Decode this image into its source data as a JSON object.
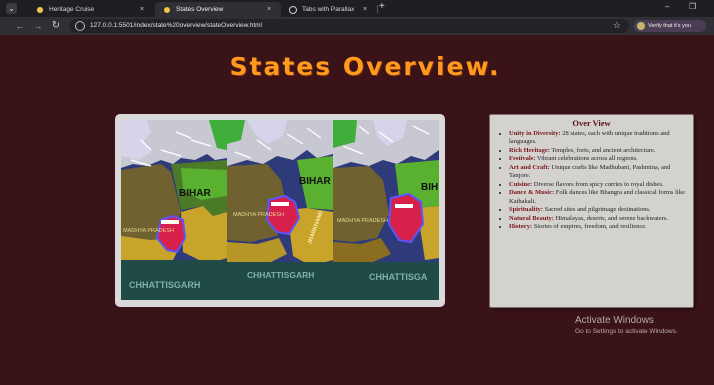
{
  "browser": {
    "tabs": [
      {
        "title": "Heritage Cruise",
        "close": "×",
        "active": false
      },
      {
        "title": "States Overview",
        "close": "×",
        "active": true
      },
      {
        "title": "Tabs with Parallax Carousel",
        "close": "×",
        "active": false
      }
    ],
    "new_tab": "+",
    "minimize": "–",
    "restore": "❐",
    "url": "127.0.0.1:5501/index/state%20overview/stateOverview.html",
    "verify_label": "Verify that it's you",
    "icons": {
      "back": "arrow-left",
      "forward": "arrow-right",
      "reload": "reload",
      "bookmark": "star"
    }
  },
  "page": {
    "heading": "States Overview.",
    "map_labels": {
      "p1": [
        "BIHAR",
        "MADHYA PRADESH",
        "CHHATTISGARH"
      ],
      "p2": [
        "BIHAR",
        "MADHYA PRADESH",
        "JHARKHAND",
        "CHHATTISGARH"
      ],
      "p3": [
        "BIH",
        "MADHYA PRADESH",
        "CHHATTISGA"
      ]
    },
    "overview": {
      "title": "Over View",
      "items": [
        {
          "term": "Unity in Diversity:",
          "text": "28 states, each with unique traditions and languages."
        },
        {
          "term": "Rich Heritage:",
          "text": "Temples, forts, and ancient architecture."
        },
        {
          "term": "Festivals:",
          "text": "Vibrant celebrations across all regions."
        },
        {
          "term": "Art and Craft:",
          "text": "Unique crafts like Madhubani, Pashmina, and Tanjore."
        },
        {
          "term": "Cuisine:",
          "text": "Diverse flavors from spicy curries to royal dishes."
        },
        {
          "term": "Dance & Music:",
          "text": "Folk dances like Bhangra and classical forms like Kathakali."
        },
        {
          "term": "Spirituality:",
          "text": "Sacred sites and pilgrimage destinations."
        },
        {
          "term": "Natural Beauty:",
          "text": "Himalayas, deserts, and serene backwaters."
        },
        {
          "term": "History:",
          "text": "Stories of empires, freedom, and resilience."
        }
      ]
    },
    "watermark": {
      "line1": "Activate Windows",
      "line2": "Go to Settings to activate Windows."
    }
  },
  "colors": {
    "page_bg": "#3a1318",
    "heading": "#ff9a1e",
    "term": "#7a1418"
  }
}
